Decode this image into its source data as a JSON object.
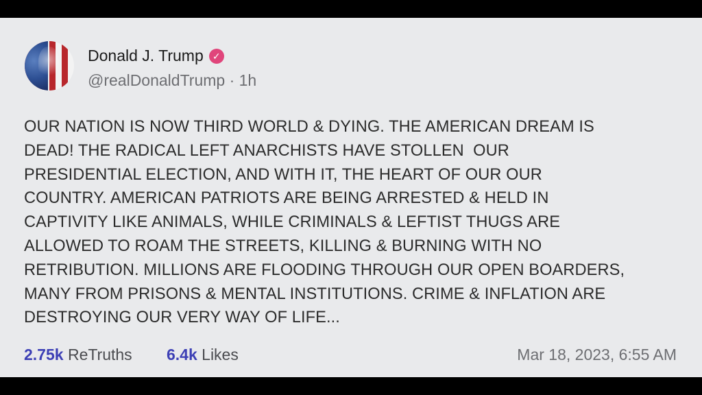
{
  "post": {
    "author_name": "Donald J. Trump",
    "handle": "@realDonaldTrump",
    "separator": "·",
    "age": "1h",
    "body": "OUR NATION IS NOW THIRD WORLD & DYING. THE AMERICAN DREAM IS\nDEAD! THE RADICAL LEFT ANARCHISTS HAVE STOLLEN  OUR\nPRESIDENTIAL ELECTION, AND WITH IT, THE HEART OF OUR OUR\nCOUNTRY. AMERICAN PATRIOTS ARE BEING ARRESTED & HELD IN\nCAPTIVITY LIKE ANIMALS, WHILE CRIMINALS & LEFTIST THUGS ARE\nALLOWED TO ROAM THE STREETS, KILLING & BURNING WITH NO\nRETRIBUTION. MILLIONS ARE FLOODING THROUGH OUR OPEN BOARDERS,\nMANY FROM PRISONS & MENTAL INSTITUTIONS. CRIME & INFLATION ARE\nDESTROYING OUR VERY WAY OF LIFE...",
    "retruths_count": "2.75k",
    "retruths_label": "ReTruths",
    "likes_count": "6.4k",
    "likes_label": "Likes",
    "timestamp": "Mar 18, 2023, 6:55 AM"
  },
  "icons": {
    "verified": "verified-badge-icon",
    "avatar": "flag-portrait-avatar"
  },
  "colors": {
    "background": "#e9eaec",
    "stat_number": "#3c3fb5",
    "verified_badge": "#e0457b",
    "muted_text": "#6d6e72"
  }
}
